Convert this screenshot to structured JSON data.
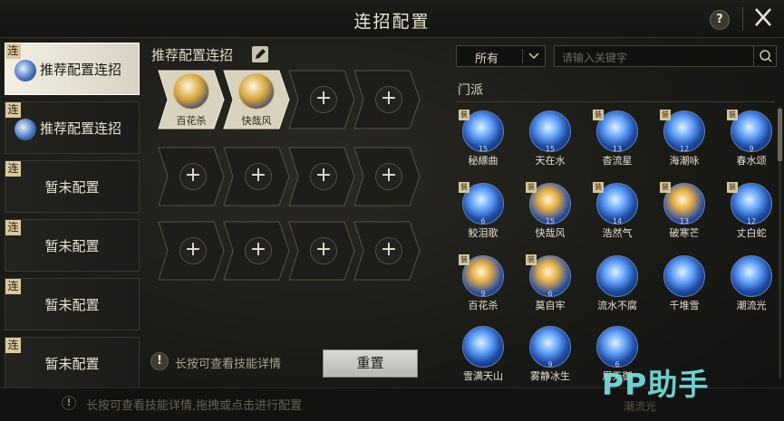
{
  "header": {
    "title": "连招配置",
    "help": "?"
  },
  "slots": [
    {
      "tag": "连",
      "label": "推荐配置连招",
      "active": true,
      "icon": true
    },
    {
      "tag": "连",
      "label": "推荐配置连招",
      "active": false,
      "icon": true
    },
    {
      "tag": "连",
      "label": "暂未配置",
      "active": false,
      "icon": false
    },
    {
      "tag": "连",
      "label": "暂未配置",
      "active": false,
      "icon": false
    },
    {
      "tag": "连",
      "label": "暂未配置",
      "active": false,
      "icon": false
    },
    {
      "tag": "连",
      "label": "暂未配置",
      "active": false,
      "icon": false
    }
  ],
  "combo": {
    "title": "推荐配置连招",
    "rows": [
      [
        {
          "skill": "百花杀"
        },
        {
          "skill": "快哉风"
        },
        {
          "skill": null
        },
        {
          "skill": null
        }
      ],
      [
        {
          "skill": null
        },
        {
          "skill": null
        },
        {
          "skill": null
        },
        {
          "skill": null
        }
      ],
      [
        {
          "skill": null
        },
        {
          "skill": null
        },
        {
          "skill": null
        },
        {
          "skill": null
        }
      ]
    ],
    "plus": "+"
  },
  "hint": {
    "icon": "!",
    "text": "长按可查看技能详情"
  },
  "reset_label": "重置",
  "filter": {
    "selected": "所有"
  },
  "search": {
    "placeholder": "请输入关键字"
  },
  "section": "门派",
  "skills": [
    {
      "name": "秘縹曲",
      "level": "15",
      "equip": true,
      "gold": false
    },
    {
      "name": "天在水",
      "level": "15",
      "equip": false,
      "gold": false
    },
    {
      "name": "杳流星",
      "level": "13",
      "equip": true,
      "gold": false
    },
    {
      "name": "海潮咏",
      "level": "12",
      "equip": true,
      "gold": false
    },
    {
      "name": "春水颂",
      "level": "9",
      "equip": true,
      "gold": false
    },
    {
      "name": "鲛泪歌",
      "level": "6",
      "equip": true,
      "gold": false
    },
    {
      "name": "快哉风",
      "level": "15",
      "equip": true,
      "gold": true
    },
    {
      "name": "浩然气",
      "level": "14",
      "equip": true,
      "gold": false
    },
    {
      "name": "破寒芒",
      "level": "13",
      "equip": true,
      "gold": true
    },
    {
      "name": "丈白蛇",
      "level": "12",
      "equip": true,
      "gold": false
    },
    {
      "name": "百花杀",
      "level": "9",
      "equip": true,
      "gold": true
    },
    {
      "name": "莫自牢",
      "level": "6",
      "equip": true,
      "gold": true
    },
    {
      "name": "流水不腐",
      "level": "",
      "equip": false,
      "gold": false
    },
    {
      "name": "千堆雪",
      "level": "",
      "equip": false,
      "gold": false
    },
    {
      "name": "潮流光",
      "level": "",
      "equip": false,
      "gold": false
    },
    {
      "name": "雪满天山",
      "level": "",
      "equip": false,
      "gold": false
    },
    {
      "name": "雾静冰生",
      "level": "9",
      "equip": false,
      "gold": false
    },
    {
      "name": "周天御",
      "level": "6",
      "equip": false,
      "gold": false
    }
  ],
  "footer": {
    "icon": "!",
    "text": "长按可查看技能详情,拖拽或点击进行配置",
    "ghost": "潮流光"
  },
  "watermark": {
    "pp": "PP",
    "rest": "助手"
  },
  "colors": {
    "accent_gold": "#d4b56a",
    "text": "#e6e0cf",
    "active_slot": "#eeeadf",
    "watermark": "#78dee2"
  },
  "icons": {
    "help": "question-icon",
    "close": "close-icon",
    "edit": "pencil-icon",
    "search": "search-icon",
    "caret": "chevron-down-icon",
    "hint": "exclamation-icon"
  }
}
